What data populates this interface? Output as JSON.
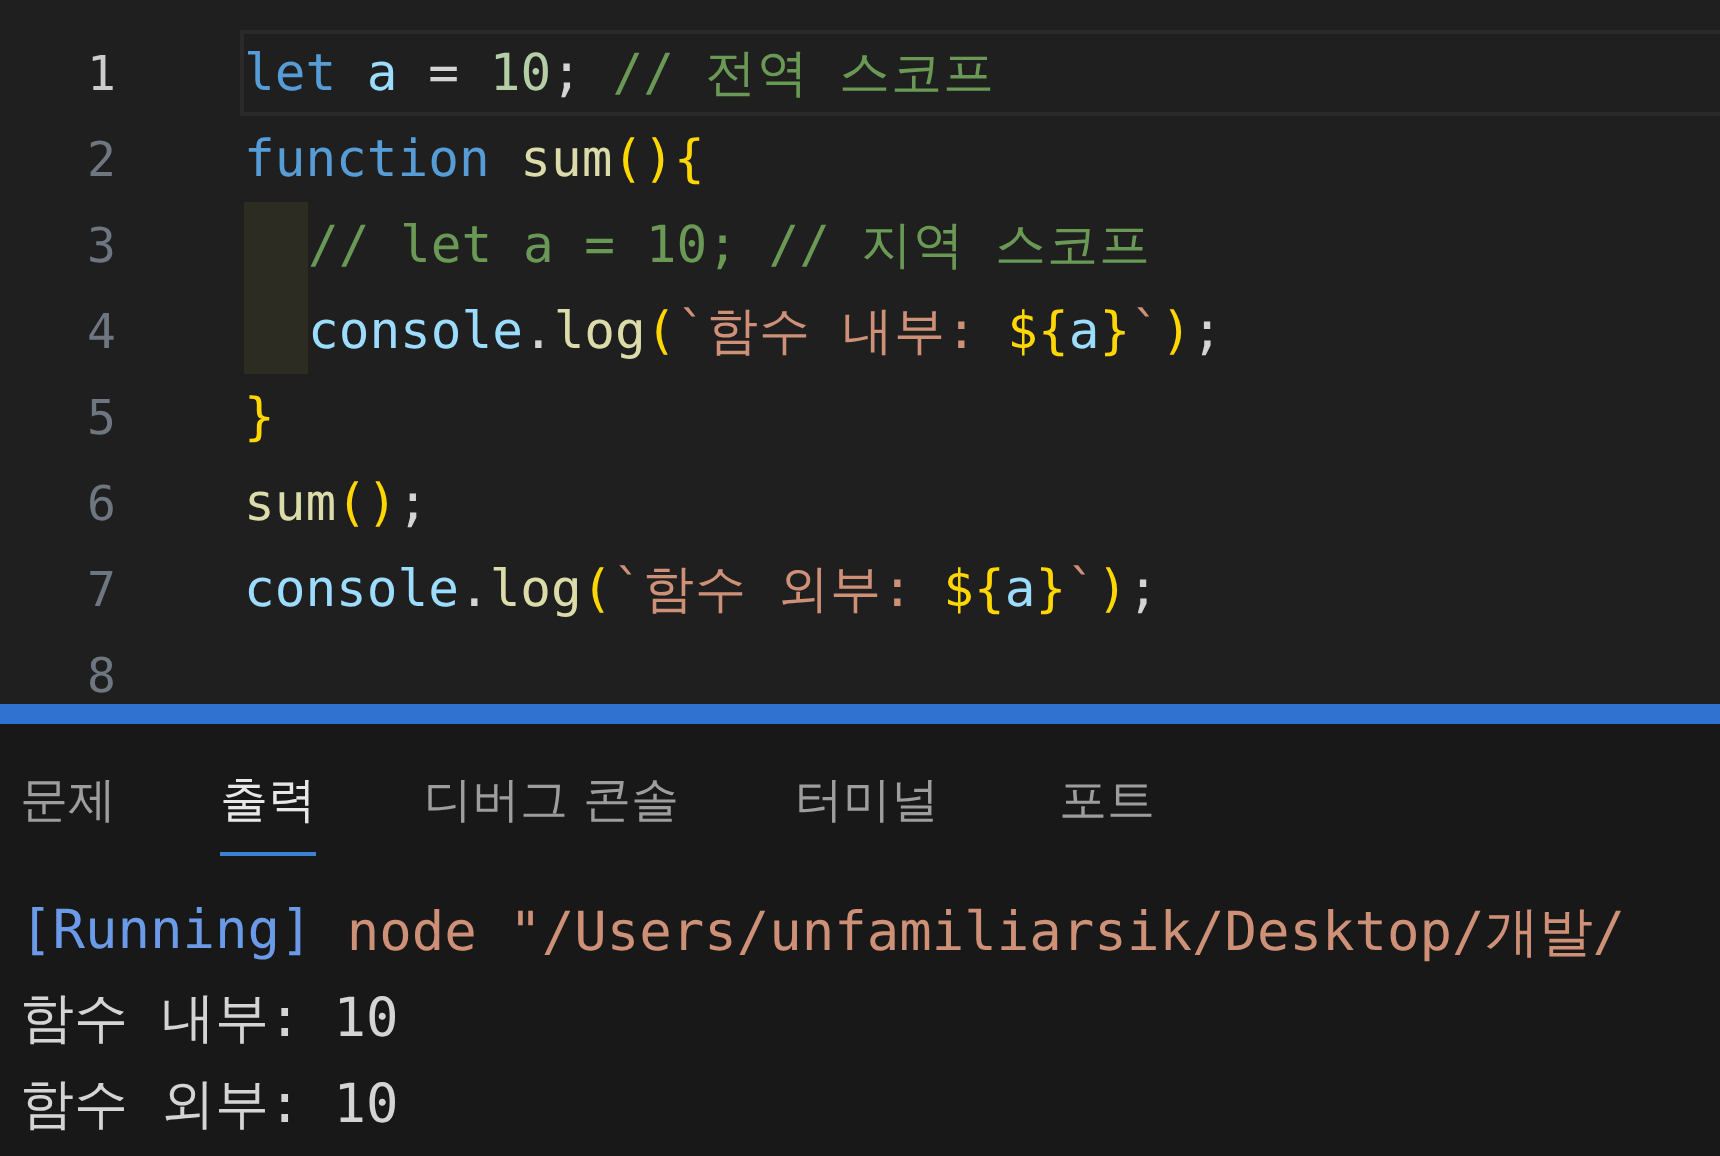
{
  "editor": {
    "lines": [
      {
        "number": "1",
        "current": true,
        "indented": false,
        "tokens": [
          {
            "kind": "keyword",
            "text": "let "
          },
          {
            "kind": "variable",
            "text": "a"
          },
          {
            "kind": "plain",
            "text": " = "
          },
          {
            "kind": "number",
            "text": "10"
          },
          {
            "kind": "plain",
            "text": "; "
          },
          {
            "kind": "comment",
            "text": "// 전역 스코프"
          }
        ]
      },
      {
        "number": "2",
        "current": false,
        "indented": false,
        "tokens": [
          {
            "kind": "keyword",
            "text": "function "
          },
          {
            "kind": "function",
            "text": "sum"
          },
          {
            "kind": "bracket",
            "text": "(){"
          }
        ]
      },
      {
        "number": "3",
        "current": false,
        "indented": true,
        "tokens": [
          {
            "kind": "comment",
            "text": "// let a = 10; // 지역 스코프"
          }
        ]
      },
      {
        "number": "4",
        "current": false,
        "indented": true,
        "tokens": [
          {
            "kind": "variable",
            "text": "console"
          },
          {
            "kind": "plain",
            "text": "."
          },
          {
            "kind": "function",
            "text": "log"
          },
          {
            "kind": "bracket",
            "text": "("
          },
          {
            "kind": "string",
            "text": "`함수 내부: "
          },
          {
            "kind": "bracket",
            "text": "${"
          },
          {
            "kind": "variable",
            "text": "a"
          },
          {
            "kind": "bracket",
            "text": "}"
          },
          {
            "kind": "string",
            "text": "`"
          },
          {
            "kind": "bracket",
            "text": ")"
          },
          {
            "kind": "plain",
            "text": ";"
          }
        ]
      },
      {
        "number": "5",
        "current": false,
        "indented": false,
        "tokens": [
          {
            "kind": "bracket",
            "text": "}"
          }
        ]
      },
      {
        "number": "6",
        "current": false,
        "indented": false,
        "tokens": [
          {
            "kind": "function",
            "text": "sum"
          },
          {
            "kind": "bracket",
            "text": "()"
          },
          {
            "kind": "plain",
            "text": ";"
          }
        ]
      },
      {
        "number": "7",
        "current": false,
        "indented": false,
        "tokens": [
          {
            "kind": "variable",
            "text": "console"
          },
          {
            "kind": "plain",
            "text": "."
          },
          {
            "kind": "function",
            "text": "log"
          },
          {
            "kind": "bracket",
            "text": "("
          },
          {
            "kind": "string",
            "text": "`함수 외부: "
          },
          {
            "kind": "bracket",
            "text": "${"
          },
          {
            "kind": "variable",
            "text": "a"
          },
          {
            "kind": "bracket",
            "text": "}"
          },
          {
            "kind": "string",
            "text": "`"
          },
          {
            "kind": "bracket",
            "text": ")"
          },
          {
            "kind": "plain",
            "text": ";"
          }
        ]
      },
      {
        "number": "8",
        "current": false,
        "indented": false
      }
    ]
  },
  "panel": {
    "tabs": [
      {
        "label": "문제",
        "selected": false
      },
      {
        "label": "출력",
        "selected": true
      },
      {
        "label": "디버그 콘솔",
        "selected": false
      },
      {
        "label": "터미널",
        "selected": false
      },
      {
        "label": "포트",
        "selected": false
      }
    ],
    "output": [
      {
        "kind": "command",
        "parts": [
          {
            "kind": "status",
            "text": "[Running]"
          },
          {
            "kind": "path",
            "text": "node \"/Users/unfamiliarsik/Desktop/개발/"
          }
        ]
      },
      {
        "kind": "plain",
        "parts": [
          {
            "kind": "plain",
            "text": "함수 내부: 10"
          }
        ]
      },
      {
        "kind": "plain",
        "parts": [
          {
            "kind": "plain",
            "text": "함수 외부: 10"
          }
        ]
      }
    ]
  }
}
